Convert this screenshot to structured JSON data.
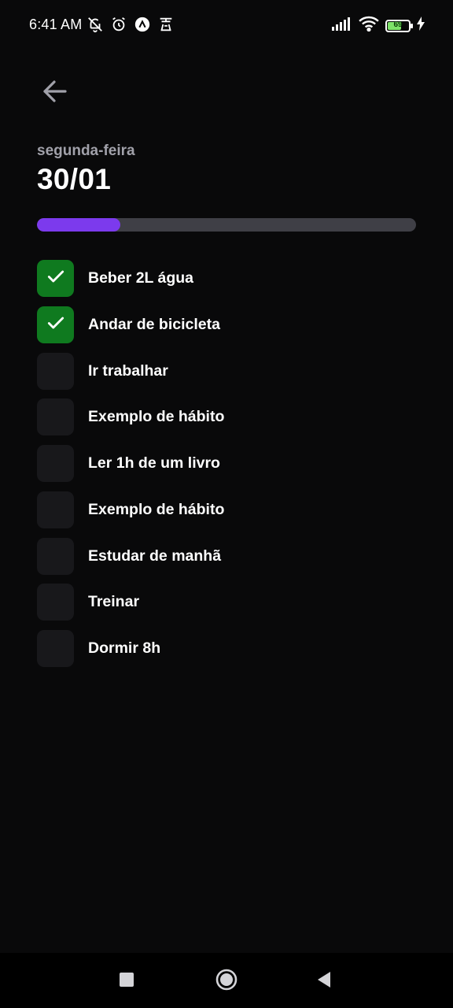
{
  "status": {
    "time": "6:41 AM",
    "battery_level": "69",
    "battery_fraction": 0.69,
    "left_icons": [
      "notifications-off-icon",
      "alarm-icon",
      "app-notification-icon",
      "app-notification-icon-2"
    ],
    "right_icons": [
      "signal-icon",
      "wifi-icon",
      "battery-icon",
      "charging-icon"
    ]
  },
  "header": {
    "weekday": "segunda-feira",
    "date": "30/01"
  },
  "progress": {
    "fraction": 0.22,
    "colors": {
      "fill": "#7c3aed",
      "track": "#3f3f46"
    }
  },
  "habits": [
    {
      "label": "Beber 2L água",
      "checked": true
    },
    {
      "label": "Andar de bicicleta",
      "checked": true
    },
    {
      "label": "Ir trabalhar",
      "checked": false
    },
    {
      "label": "Exemplo de hábito",
      "checked": false
    },
    {
      "label": "Ler 1h de um livro",
      "checked": false
    },
    {
      "label": "Exemplo de hábito",
      "checked": false
    },
    {
      "label": "Estudar de manhã",
      "checked": false
    },
    {
      "label": "Treinar",
      "checked": false
    },
    {
      "label": "Dormir 8h",
      "checked": false
    }
  ],
  "colors": {
    "background": "#09090a",
    "checked": "#0f7a1f",
    "unchecked": "#18181b"
  },
  "nav": {
    "icons": [
      "recents-icon",
      "home-icon",
      "back-nav-icon"
    ]
  }
}
